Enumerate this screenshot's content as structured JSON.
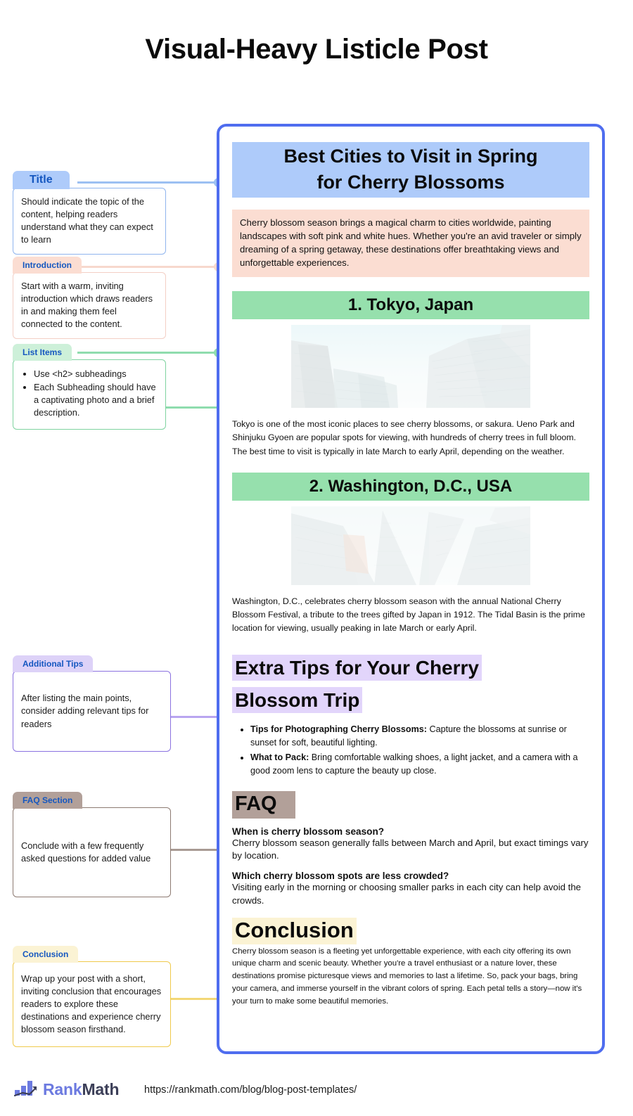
{
  "page_title": "Visual-Heavy Listicle Post",
  "colors": {
    "panel_border": "#4f6def",
    "title_highlight": "#aecbfa",
    "intro_highlight": "#fbddd2",
    "section_highlight": "#96e0ad",
    "tips_highlight": "#e2d5fb",
    "faq_highlight": "#b2a099",
    "conclusion_highlight": "#fbf3d4"
  },
  "annotations": [
    {
      "key": "title",
      "chip": "Title",
      "text": "Should indicate the topic of the content, helping readers understand what they can expect to learn",
      "chip_bg": "#aecbfa",
      "border": "#8fb4ee",
      "line": "#9cc0f2"
    },
    {
      "key": "introduction",
      "chip": "Introduction",
      "text": "Start with a warm, inviting introduction which draws readers in and making them feel connected to the content.",
      "chip_bg": "#fbddd2",
      "border": "#f3cfc5",
      "line": "#f7d8cd"
    },
    {
      "key": "list_items",
      "chip": "List Items",
      "bullets": [
        "Use <h2> subheadings",
        "Each Subheading should have a captivating photo and a brief description."
      ],
      "chip_bg": "#cdf0d9",
      "border": "#7fd3a0",
      "line": "#8fdcae"
    },
    {
      "key": "additional_tips",
      "chip": "Additional Tips",
      "text": "After listing the main points, consider adding relevant tips for readers",
      "chip_bg": "#ddd2f8",
      "border": "#8b72e0",
      "line": "#b9a5f0"
    },
    {
      "key": "faq_section",
      "chip": "FAQ Section",
      "text": "Conclude with a few frequently asked questions for added value",
      "chip_bg": "#b2a099",
      "border": "#8d7a72",
      "line": "#a89a93"
    },
    {
      "key": "conclusion",
      "chip": "Conclusion",
      "text": "Wrap up your post with a short, inviting conclusion that encourages readers to explore these destinations and experience cherry blossom season firsthand.",
      "chip_bg": "#fbf3d4",
      "border": "#efc94c",
      "line": "#f3d776"
    }
  ],
  "document": {
    "title_line1": "Best Cities to Visit in Spring",
    "title_line2": "for Cherry Blossoms",
    "introduction": "Cherry blossom season brings a magical charm to cities worldwide, painting landscapes with soft pink and white hues. Whether you're an avid traveler or simply dreaming of a spring getaway, these destinations offer breathtaking views and unforgettable experiences.",
    "sections": [
      {
        "heading": "1. Tokyo, Japan",
        "image_alt": "low-angle-photo-of-glass-skyscrapers",
        "body": "Tokyo is one of the most iconic places to see cherry blossoms, or sakura. Ueno Park and Shinjuku Gyoen are popular spots for viewing, with hundreds of cherry trees in full bloom. The best time to visit is typically in late March to early April, depending on the weather."
      },
      {
        "heading": "2. Washington, D.C., USA",
        "image_alt": "low-angle-photo-of-city-towers",
        "body": "Washington, D.C., celebrates cherry blossom season with the annual National Cherry Blossom Festival, a tribute to the trees gifted by Japan in 1912. The Tidal Basin is the prime location for viewing, usually peaking in late March or early April."
      }
    ],
    "tips": {
      "heading_line1": "Extra Tips for Your Cherry",
      "heading_line2": "Blossom Trip",
      "items": [
        {
          "label": "Tips for Photographing Cherry Blossoms:",
          "text": " Capture the blossoms at sunrise or sunset for soft, beautiful lighting."
        },
        {
          "label": "What to Pack:",
          "text": " Bring comfortable walking shoes, a light jacket, and a camera with a good zoom lens to capture the beauty up close."
        }
      ]
    },
    "faq": {
      "heading": "FAQ",
      "items": [
        {
          "question": "When is cherry blossom season?",
          "answer": "Cherry blossom season generally falls between March and April, but exact timings vary by location."
        },
        {
          "question": "Which cherry blossom spots are less crowded?",
          "answer": "Visiting early in the morning or choosing smaller parks in each city can help avoid the crowds."
        }
      ]
    },
    "conclusion": {
      "heading": "Conclusion",
      "body": "Cherry blossom season is a fleeting yet unforgettable experience, with each city offering its own unique charm and scenic beauty. Whether you're a travel enthusiast or a nature lover, these destinations promise picturesque views and memories to last a lifetime. So, pack your bags, bring your camera, and immerse yourself in the vibrant colors of spring. Each petal tells a story—now it's your turn to make some beautiful memories."
    }
  },
  "footer": {
    "logo_rank": "Rank",
    "logo_math": "Math",
    "url": "https://rankmath.com/blog/blog-post-templates/"
  }
}
